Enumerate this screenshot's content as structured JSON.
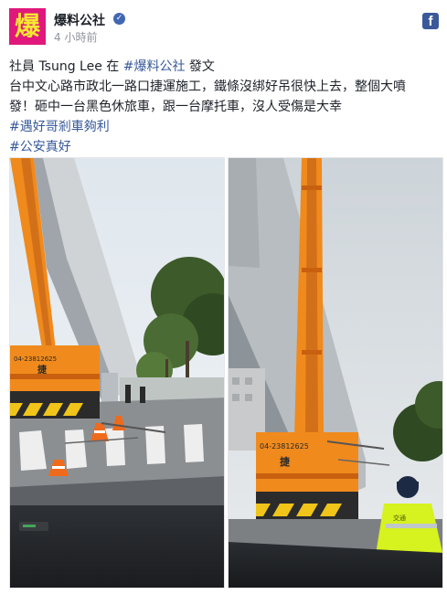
{
  "post": {
    "author": "爆料公社",
    "avatar_text": "爆",
    "verified_icon": "verified-badge-icon",
    "timestamp": "4 小時前",
    "network_icon": "facebook-icon",
    "network_glyph": "f"
  },
  "text": {
    "line1_prefix": "社員 Tsung Lee 在 ",
    "line1_tag": "#爆料公社",
    "line1_suffix": " 發文",
    "line2": "台中文心路市政北一路口捷運施工，鐵條沒綁好吊很快上去，整個大噴",
    "line3": "發！砸中一台黑色休旅車，跟一台摩托車，沒人受傷是大幸",
    "hashtag1": "#遇好哥剎車夠利",
    "hashtag2": "#公安真好"
  },
  "photos": [
    {
      "crane_phone": "04-23812625",
      "crane_char": "捷",
      "subject": "crane-left"
    },
    {
      "crane_phone": "04-23812625",
      "crane_char": "捷",
      "vest_text": "交通",
      "subject": "crane-right"
    }
  ],
  "colors": {
    "brand_magenta": "#e0187b",
    "brand_yellow": "#f7e832",
    "link": "#365899",
    "crane_orange": "#f08a1c",
    "vest_yellow": "#d6f21f"
  }
}
